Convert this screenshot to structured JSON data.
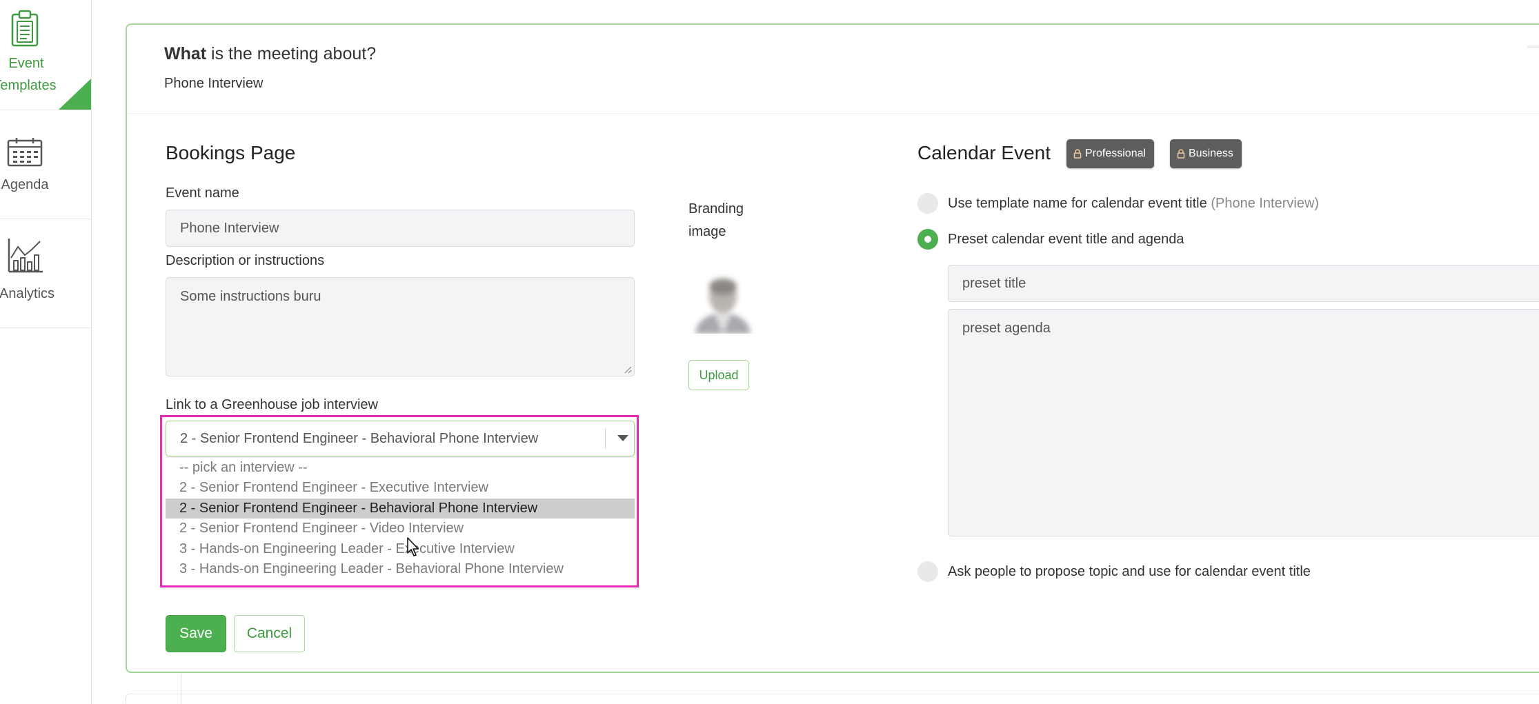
{
  "sidebar": {
    "items": [
      {
        "label_line1": "Event",
        "label_line2": "Templates",
        "icon": "clipboard-icon",
        "active": true
      },
      {
        "label": "Agenda",
        "icon": "calendar-icon",
        "active": false
      },
      {
        "label": "Analytics",
        "icon": "bar-chart-icon",
        "active": false
      }
    ]
  },
  "header": {
    "what_bold": "What",
    "what_rest": " is the meeting about?",
    "meeting_name": "Phone Interview"
  },
  "bookings": {
    "title": "Bookings Page",
    "event_name_label": "Event name",
    "event_name_value": "Phone Interview",
    "description_label": "Description or instructions",
    "description_value": "Some instructions buru",
    "greenhouse_label": "Link to a Greenhouse job interview",
    "greenhouse_selected": "2 - Senior Frontend Engineer - Behavioral Phone Interview",
    "greenhouse_options": [
      "-- pick an interview --",
      "2 - Senior Frontend Engineer - Executive Interview",
      "2 - Senior Frontend Engineer - Behavioral Phone Interview",
      "2 - Senior Frontend Engineer - Video Interview",
      "3 - Hands-on Engineering Leader - Executive Interview",
      "3 - Hands-on Engineering Leader - Behavioral Phone Interview"
    ],
    "highlighted_option_index": 2,
    "save_label": "Save",
    "cancel_label": "Cancel"
  },
  "branding": {
    "label_line1": "Branding",
    "label_line2": "image",
    "upload_label": "Upload"
  },
  "calendar_event": {
    "title": "Calendar Event",
    "badges": [
      "Professional",
      "Business"
    ],
    "options": [
      {
        "label": "Use template name for calendar event title",
        "suffix": "(Phone Interview)",
        "selected": false
      },
      {
        "label": "Preset calendar event title and agenda",
        "selected": true
      },
      {
        "label": "Ask people to propose topic and use for calendar event title",
        "selected": false
      }
    ],
    "preset_title_placeholder": "preset title",
    "preset_agenda_placeholder": "preset agenda"
  },
  "colors": {
    "accent": "#4caf50",
    "card_border": "#a6d69a",
    "highlight": "#e62ab8",
    "badge_bg": "#5d5d5d"
  }
}
